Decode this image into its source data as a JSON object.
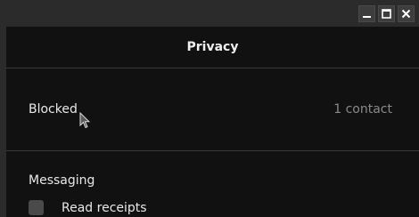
{
  "window": {
    "controls": {
      "minimize_icon": "minimize-icon",
      "maximize_icon": "maximize-icon",
      "close_icon": "close-icon"
    }
  },
  "privacy": {
    "title": "Privacy",
    "blocked": {
      "label": "Blocked",
      "value": "1 contact"
    },
    "messaging": {
      "section_label": "Messaging",
      "read_receipts": {
        "label": "Read receipts",
        "checked": false
      }
    }
  },
  "colors": {
    "background": "#111111",
    "chrome": "#2b2b2b",
    "text": "#e8e8e8",
    "muted_text": "#8a8a8a",
    "divider": "#3a3a3a"
  }
}
